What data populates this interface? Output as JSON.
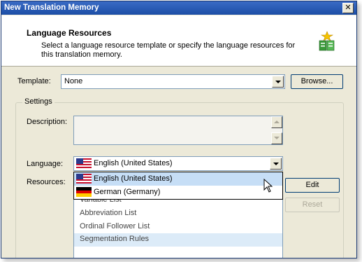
{
  "window": {
    "title": "New Translation Memory",
    "close_label": "✕"
  },
  "header": {
    "title": "Language Resources",
    "description": "Select a language resource template or specify the language resources for this translation memory."
  },
  "template": {
    "label": "Template:",
    "value": "None",
    "browse_label": "Browse..."
  },
  "settings": {
    "group_label": "Settings",
    "description_label": "Description:",
    "language_label": "Language:",
    "language_value": "English (United States)",
    "resources_label": "Resources:",
    "edit_label": "Edit",
    "reset_label": "Reset"
  },
  "language_dropdown": {
    "options": [
      {
        "label": "English (United States)",
        "flag": "us-flag-icon",
        "selected": true
      },
      {
        "label": "German (Germany)",
        "flag": "de-flag-icon",
        "selected": false
      }
    ]
  },
  "resources_list": {
    "items": [
      "Variable List",
      "Abbreviation List",
      "Ordinal Follower List",
      "Segmentation Rules"
    ],
    "selected": "Segmentation Rules"
  },
  "colors": {
    "titlebar": "#1c4ea6",
    "dialog_bg": "#ece9d8",
    "selection": "#c6def6"
  }
}
